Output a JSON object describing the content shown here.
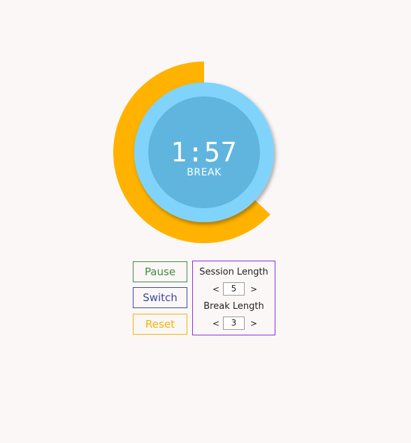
{
  "timer": {
    "time": "1:57",
    "mode": "BREAK",
    "progress_fraction": 0.63
  },
  "controls": {
    "pause_label": "Pause",
    "switch_label": "Switch",
    "reset_label": "Reset"
  },
  "settings": {
    "session_label": "Session Length",
    "session_value": "5",
    "break_label": "Break Length",
    "break_value": "3",
    "decrement_label": "<",
    "increment_label": ">"
  },
  "colors": {
    "background": "#fcf7f7",
    "progress_ring": "#ffb300",
    "outer_circle": "#80d4fb",
    "inner_circle": "#60b5df",
    "pause": "#3f8b3f",
    "switch": "#3b46a0",
    "reset": "#f0b400",
    "settings_border": "#8a2be2"
  }
}
